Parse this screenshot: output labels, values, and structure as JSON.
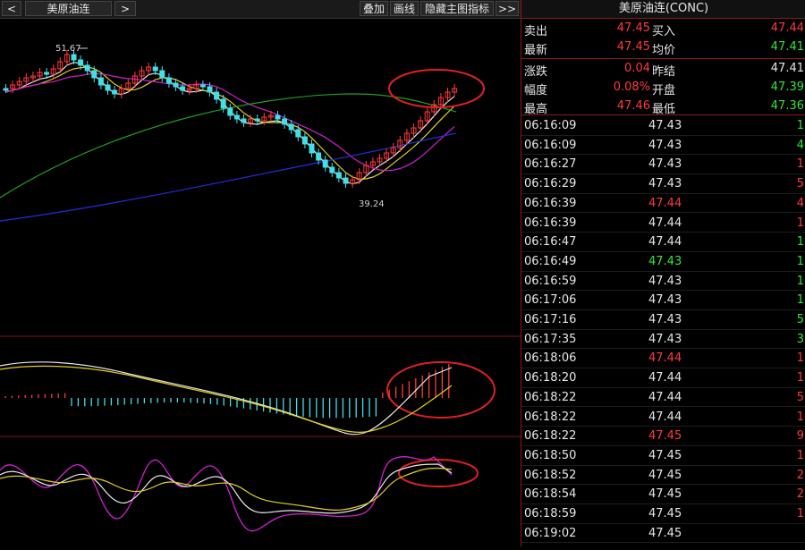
{
  "toolbar": {
    "left_arrow": "<",
    "symbol_tab": "美原油连",
    "right_arrow": ">",
    "overlay_label": "叠加",
    "draw_label": "画线",
    "hide_indicator_label": "隐藏主图指标",
    "more_label": ">>"
  },
  "chart": {
    "high_label": "51.67",
    "low_label": "39.24"
  },
  "quote": {
    "title": "美原油连(CONC)",
    "rows": [
      {
        "label1": "卖出",
        "value1": "47.45",
        "color1": "#ff3a3a",
        "label2": "买入",
        "value2": "47.44",
        "color2": "#ff3a3a"
      },
      {
        "label1": "最新",
        "value1": "47.45",
        "color1": "#ff3a3a",
        "label2": "均价",
        "value2": "47.41",
        "color2": "#32e632"
      },
      {
        "label1": "涨跌",
        "value1": "0.04",
        "color1": "#ff3a3a",
        "label2": "昨结",
        "value2": "47.41",
        "color2": "#e6e6e6"
      },
      {
        "label1": "幅度",
        "value1": "0.08%",
        "color1": "#ff3a3a",
        "label2": "开盘",
        "value2": "47.39",
        "color2": "#32e632"
      },
      {
        "label1": "最高",
        "value1": "47.46",
        "color1": "#ff3a3a",
        "label2": "最低",
        "value2": "47.36",
        "color2": "#32e632"
      }
    ]
  },
  "ticks": [
    {
      "time": "06:16:09",
      "price": "47.43",
      "pc": "white",
      "vol": "1",
      "vc": "green"
    },
    {
      "time": "06:16:09",
      "price": "47.43",
      "pc": "white",
      "vol": "4",
      "vc": "green"
    },
    {
      "time": "06:16:27",
      "price": "47.43",
      "pc": "white",
      "vol": "1",
      "vc": "red"
    },
    {
      "time": "06:16:29",
      "price": "47.43",
      "pc": "white",
      "vol": "5",
      "vc": "red"
    },
    {
      "time": "06:16:39",
      "price": "47.44",
      "pc": "red",
      "vol": "4",
      "vc": "red"
    },
    {
      "time": "06:16:39",
      "price": "47.44",
      "pc": "white",
      "vol": "1",
      "vc": "red"
    },
    {
      "time": "06:16:47",
      "price": "47.44",
      "pc": "white",
      "vol": "1",
      "vc": "green"
    },
    {
      "time": "06:16:49",
      "price": "47.43",
      "pc": "green",
      "vol": "1",
      "vc": "green"
    },
    {
      "time": "06:16:59",
      "price": "47.43",
      "pc": "white",
      "vol": "1",
      "vc": "green"
    },
    {
      "time": "06:17:06",
      "price": "47.43",
      "pc": "white",
      "vol": "1",
      "vc": "green"
    },
    {
      "time": "06:17:16",
      "price": "47.43",
      "pc": "white",
      "vol": "5",
      "vc": "green"
    },
    {
      "time": "06:17:35",
      "price": "47.43",
      "pc": "white",
      "vol": "3",
      "vc": "green"
    },
    {
      "time": "06:18:06",
      "price": "47.44",
      "pc": "red",
      "vol": "1",
      "vc": "red"
    },
    {
      "time": "06:18:20",
      "price": "47.44",
      "pc": "white",
      "vol": "1",
      "vc": "red"
    },
    {
      "time": "06:18:22",
      "price": "47.44",
      "pc": "white",
      "vol": "5",
      "vc": "red"
    },
    {
      "time": "06:18:22",
      "price": "47.44",
      "pc": "white",
      "vol": "1",
      "vc": "red"
    },
    {
      "time": "06:18:22",
      "price": "47.45",
      "pc": "red",
      "vol": "9",
      "vc": "red"
    },
    {
      "time": "06:18:50",
      "price": "47.45",
      "pc": "white",
      "vol": "1",
      "vc": "red"
    },
    {
      "time": "06:18:52",
      "price": "47.45",
      "pc": "white",
      "vol": "2",
      "vc": "red"
    },
    {
      "time": "06:18:54",
      "price": "47.45",
      "pc": "white",
      "vol": "2",
      "vc": "red"
    },
    {
      "time": "06:18:59",
      "price": "47.45",
      "pc": "white",
      "vol": "1",
      "vc": "red"
    },
    {
      "time": "06:19:02",
      "price": "47.45",
      "pc": "white",
      "vol": "",
      "vc": "red"
    }
  ],
  "colors": {
    "up": "#ff3a3a",
    "down": "#40e0e8",
    "ma_fast": "#e8e8e8",
    "ma_mid": "#e0d020",
    "ma_slow": "#d020d0",
    "ma_green": "#20a020",
    "ma_blue": "#2030e0",
    "annotation": "#e02020"
  }
}
